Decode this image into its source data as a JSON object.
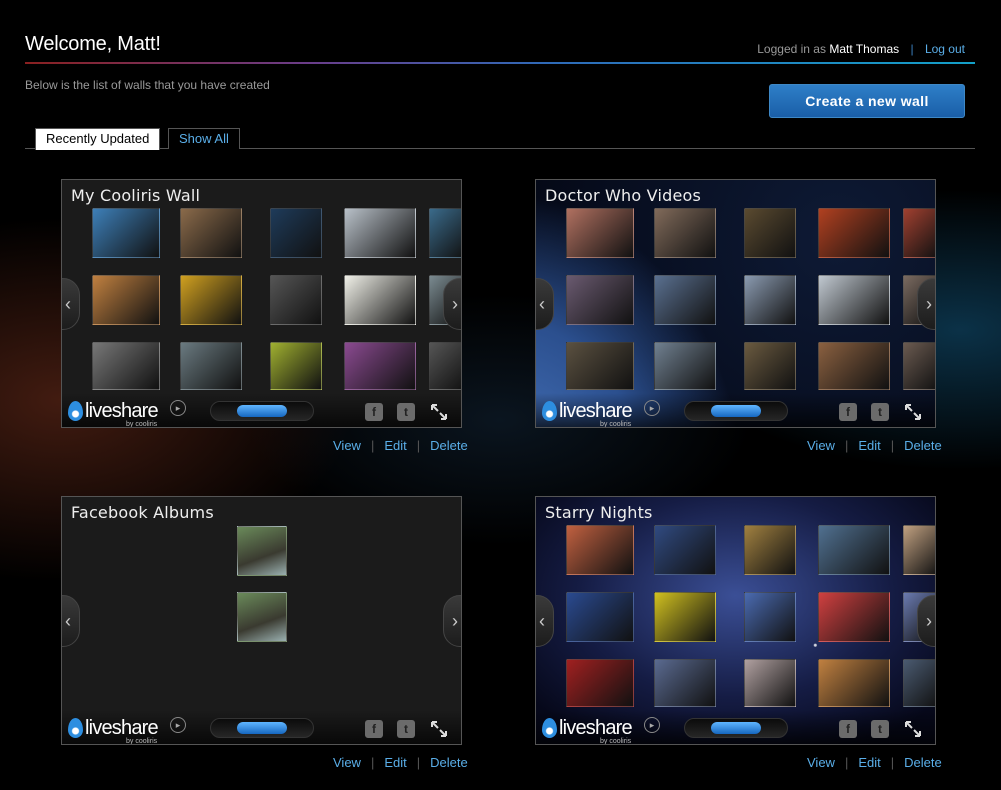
{
  "header": {
    "welcome": "Welcome, Matt!",
    "logged_in_prefix": "Logged in as",
    "user_name": "Matt Thomas",
    "separator": "|",
    "logout": "Log out",
    "subtitle": "Below is the list of walls that you have created",
    "create_button": "Create a new wall"
  },
  "tabs": [
    {
      "label": "Recently Updated",
      "active": true
    },
    {
      "label": "Show All",
      "active": false
    }
  ],
  "walls": [
    {
      "title": "My Cooliris Wall",
      "style": "plain"
    },
    {
      "title": "Doctor Who Videos",
      "style": "earth"
    },
    {
      "title": "Facebook Albums",
      "style": "plain"
    },
    {
      "title": "Starry Nights",
      "style": "stars"
    }
  ],
  "wall_footer": {
    "logo_text": "liveshare",
    "logo_by": "by cooliris",
    "facebook": "f",
    "twitter": "t"
  },
  "wall_actions": {
    "view": "View",
    "edit": "Edit",
    "delete": "Delete",
    "separator": "|"
  },
  "colors": {
    "accent": "#5aaee8",
    "button": "#2e7fc8",
    "background": "#000000"
  }
}
